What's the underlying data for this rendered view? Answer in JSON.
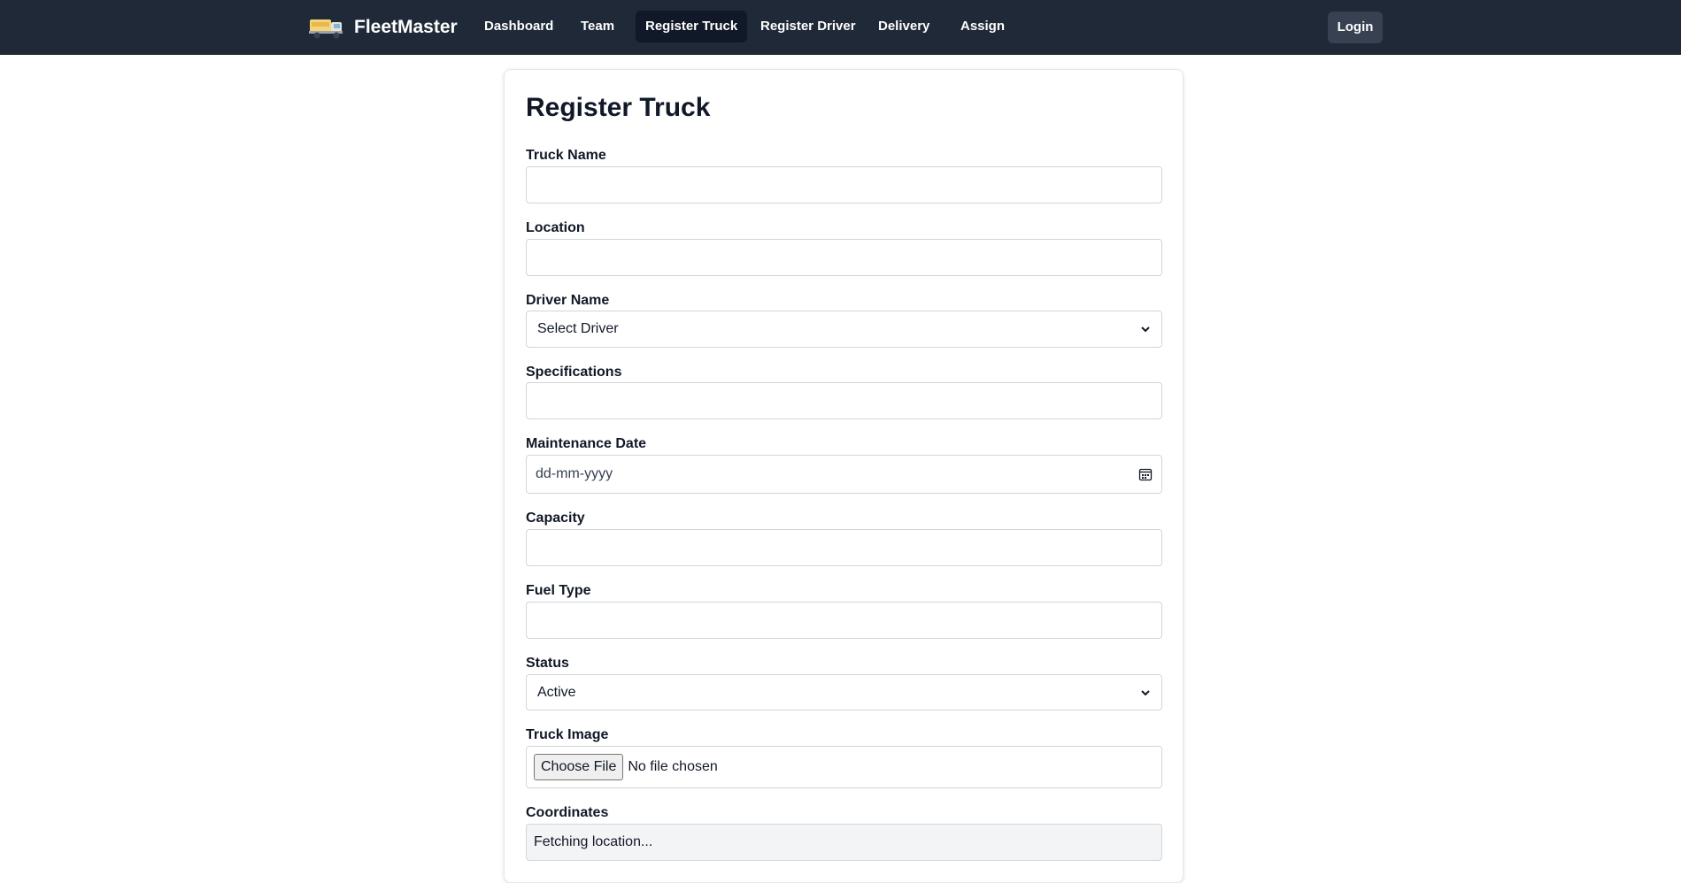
{
  "navbar": {
    "brand": "FleetMaster",
    "links": [
      "Dashboard",
      "Team",
      "Register Truck",
      "Register Driver",
      "Delivery",
      "Assign"
    ],
    "active_link": "Register Truck",
    "login_label": "Login",
    "background": "#1f2937"
  },
  "form": {
    "title": "Register Truck",
    "truck_name_label": "Truck Name",
    "truck_name_value": "",
    "location_label": "Location",
    "location_value": "",
    "driver_label": "Driver Name",
    "driver_selected": "Select Driver",
    "specifications_label": "Specifications",
    "specifications_value": "",
    "maintenance_label": "Maintenance Date",
    "maintenance_placeholder": "dd-mm-yyyy",
    "capacity_label": "Capacity",
    "capacity_value": "",
    "fuel_label": "Fuel Type",
    "fuel_value": "",
    "status_label": "Status",
    "status_selected": "Active",
    "image_label": "Truck Image",
    "file_button": "Choose File",
    "file_status": "No file chosen",
    "coordinates_label": "Coordinates",
    "coordinates_value": "Fetching location..."
  }
}
